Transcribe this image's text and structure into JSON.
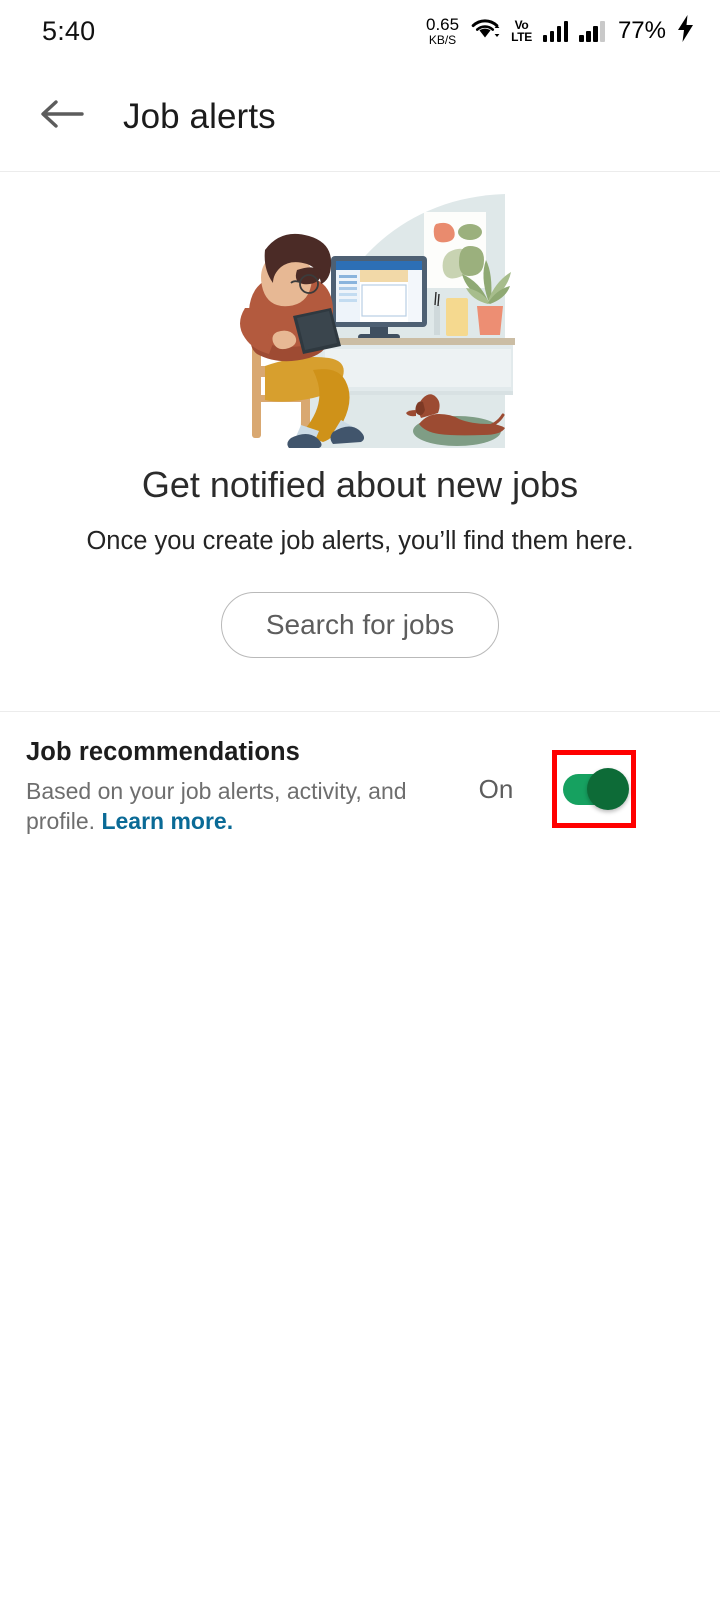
{
  "status_bar": {
    "time": "5:40",
    "net_speed_value": "0.65",
    "net_speed_unit": "KB/S",
    "wifi_icon": "wifi-icon",
    "volte_line1": "Vo",
    "volte_line2": "LTE",
    "signal_icon_1": "signal-bars-icon",
    "signal_icon_2": "signal-bars-icon",
    "battery_percent": "77%",
    "charging_icon": "charging-bolt-icon"
  },
  "app_bar": {
    "back_icon": "back-arrow-icon",
    "title": "Job alerts"
  },
  "empty_state": {
    "illustration_name": "person-at-desk-illustration",
    "title": "Get notified about new jobs",
    "subtitle": "Once you create job alerts, you’ll find them here.",
    "button_label": "Search for jobs"
  },
  "job_recommendations": {
    "title": "Job recommendations",
    "description": "Based on your job alerts, activity, and profile. ",
    "link_label": "Learn more.",
    "state_label": "On",
    "toggle_on": true
  },
  "colors": {
    "toggle_track": "#16a160",
    "toggle_thumb": "#0d6b37",
    "highlight_box": "#ff0000",
    "link": "#0a6a96"
  }
}
